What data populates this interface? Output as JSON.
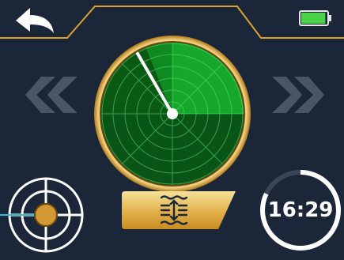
{
  "timer": {
    "value": "16:29",
    "progress": 0.82
  },
  "battery": {
    "level": 0.95,
    "color": "#4cd34a"
  },
  "radar": {
    "sweep_angle_deg": -30
  },
  "icons": {
    "back": "back-arrow-icon",
    "battery": "battery-icon",
    "previous": "double-chevron-left-icon",
    "next": "double-chevron-right-icon",
    "target": "crosshair-target-icon",
    "depth": "depth-scan-icon"
  },
  "colors": {
    "background": "#1b2638",
    "gold": "#d9a232",
    "gold_light": "#f3d785",
    "radar_green": "#0e8c1c",
    "radar_dark": "#0a5a14",
    "nav_arrows": "#4a5668"
  }
}
